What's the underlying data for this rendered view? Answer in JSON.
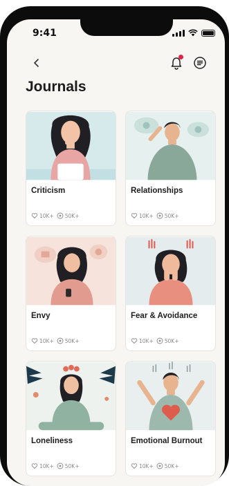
{
  "status_bar": {
    "time": "9:41"
  },
  "header": {
    "title": "Journals"
  },
  "cards": [
    {
      "title": "Criticism",
      "likes": "10K+",
      "views": "50K+"
    },
    {
      "title": "Relationships",
      "likes": "10K+",
      "views": "50K+"
    },
    {
      "title": "Envy",
      "likes": "10K+",
      "views": "50K+"
    },
    {
      "title": "Fear & Avoidance",
      "likes": "10K+",
      "views": "50K+"
    },
    {
      "title": "Loneliness",
      "likes": "10K+",
      "views": "50K+"
    },
    {
      "title": "Emotional Burnout",
      "likes": "10K+",
      "views": "50K+"
    }
  ],
  "icons": {
    "back": "chevron-left-icon",
    "notifications": "bell-icon",
    "menu": "menu-circle-icon",
    "likes": "heart-chat-icon",
    "views": "eye-icon"
  },
  "colors": {
    "notification_dot": "#e0274a",
    "background": "#f8f6f2"
  }
}
